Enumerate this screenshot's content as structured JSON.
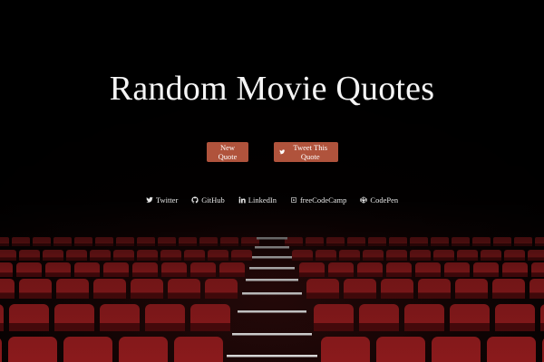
{
  "page": {
    "title": "Random Movie Quotes"
  },
  "buttons": {
    "new_quote": "New Quote",
    "tweet_quote": "Tweet This Quote",
    "tweet_icon": "twitter-icon"
  },
  "social_links": [
    {
      "label": "Twitter",
      "icon": "twitter-icon"
    },
    {
      "label": "GitHub",
      "icon": "github-icon"
    },
    {
      "label": "LinkedIn",
      "icon": "linkedin-icon"
    },
    {
      "label": "freeCodeCamp",
      "icon": "freecodecamp-icon"
    },
    {
      "label": "CodePen",
      "icon": "codepen-icon"
    }
  ],
  "colors": {
    "background": "#050303",
    "button": "#b0533c",
    "seat": "#8b1a1c",
    "text": "#ffffff"
  }
}
